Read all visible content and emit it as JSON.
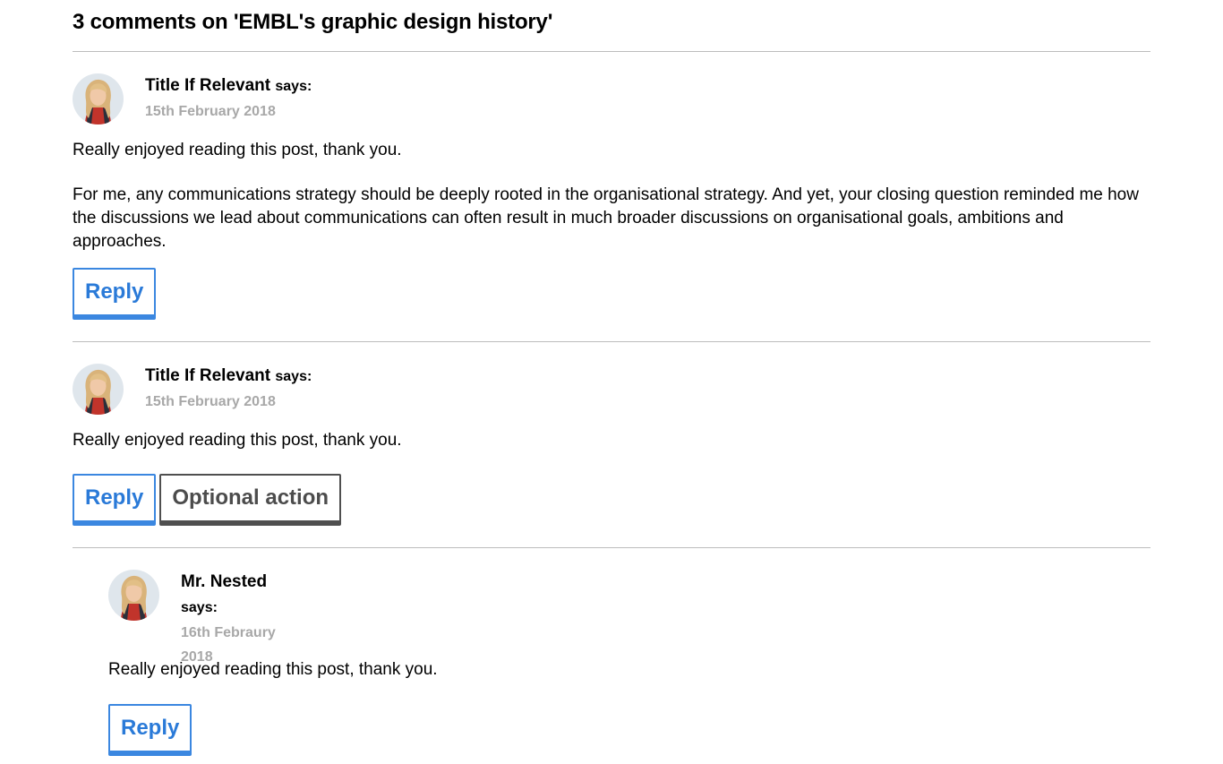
{
  "section": {
    "heading": "3 comments on 'EMBL's graphic design history'"
  },
  "comments": [
    {
      "author": "Title If Relevant",
      "says": "says:",
      "date": "15th February 2018",
      "paragraphs": [
        "Really enjoyed reading this post, thank you.",
        "For me, any communications strategy should be deeply rooted in the organisational strategy. And yet, your closing question reminded me how the discussions we lead about communications can often result in much broader discussions on organisational goals, ambitions and approaches."
      ],
      "reply_label": "Reply"
    },
    {
      "author": "Title If Relevant",
      "says": "says:",
      "date": "15th February 2018",
      "paragraphs": [
        "Really enjoyed reading this post, thank you."
      ],
      "reply_label": "Reply",
      "optional_label": "Optional action"
    },
    {
      "author": "Mr. Nested",
      "says": "says:",
      "date": "16th Febraury 2018",
      "paragraphs": [
        "Really enjoyed reading this post, thank you."
      ],
      "reply_label": "Reply"
    }
  ],
  "colors": {
    "primary_button": "#2a7ad8",
    "secondary_button": "#4c4c4c",
    "date_text": "#a8a8a8",
    "divider": "#bdbdbd"
  },
  "icons": {
    "avatar": "user-avatar-photo"
  }
}
